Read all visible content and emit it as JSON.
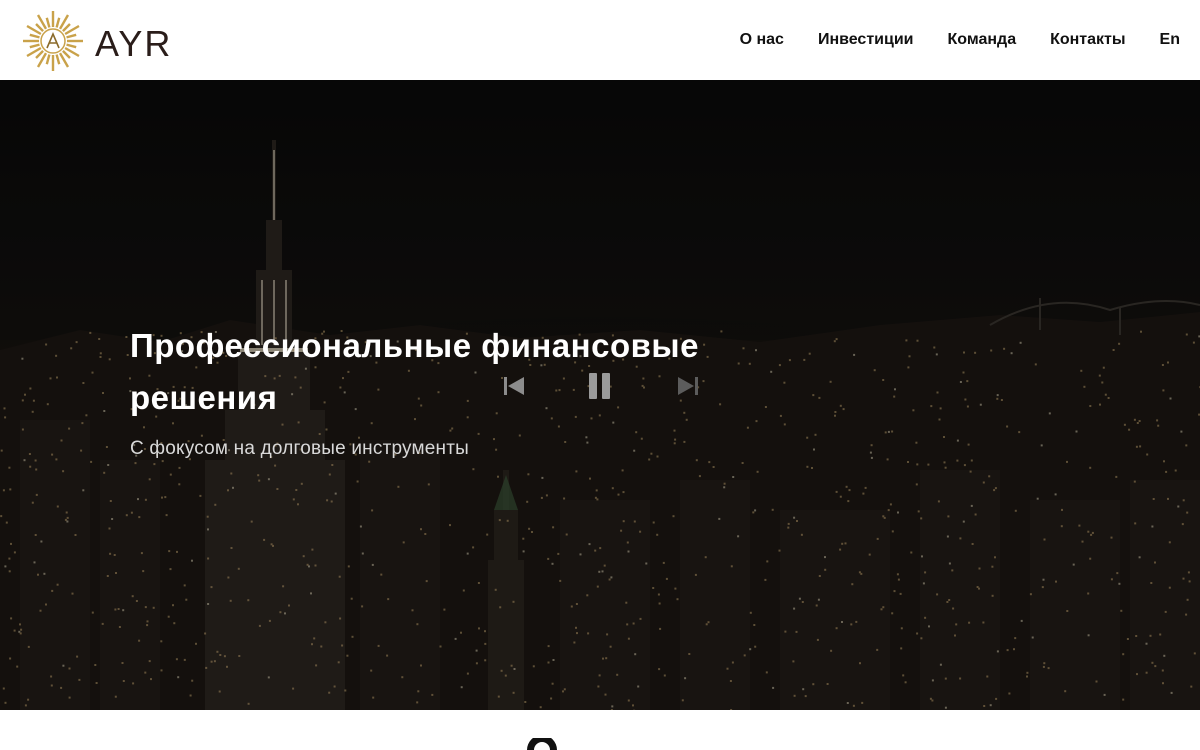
{
  "header": {
    "brand": "AYR",
    "logo_icon": "sunburst-logo-icon",
    "nav": [
      {
        "label": "О нас"
      },
      {
        "label": "Инвестиции"
      },
      {
        "label": "Команда"
      },
      {
        "label": "Контакты"
      },
      {
        "label": "En"
      }
    ]
  },
  "hero": {
    "title": "Профессиональные финансовые решения",
    "subtitle": "С фокусом на долговые инструменты",
    "controls": {
      "prev_icon": "skip-previous-icon",
      "pause_icon": "pause-icon",
      "next_icon": "skip-next-icon"
    }
  },
  "colors": {
    "header_bg": "#ffffff",
    "nav_text": "#111111",
    "brand_gold": "#c9a24a",
    "brand_text": "#2a1d1a",
    "hero_bg": "#0e0d0c",
    "hero_title": "#ffffff",
    "hero_subtitle": "#d9d9d9"
  }
}
